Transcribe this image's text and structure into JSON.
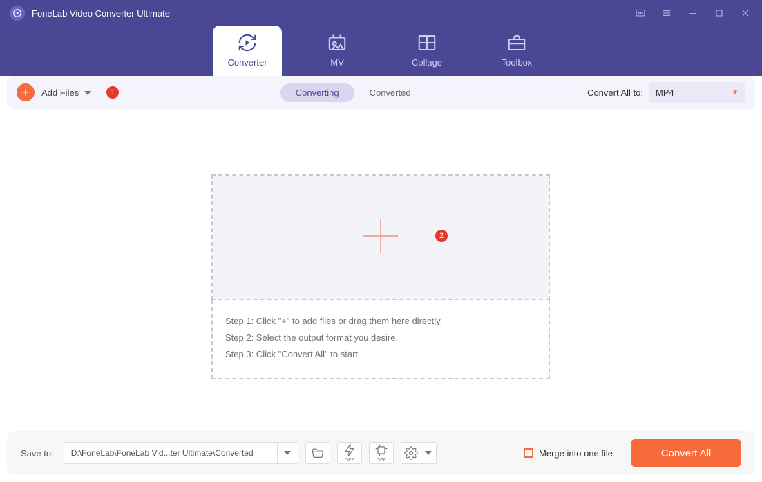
{
  "app": {
    "title": "FoneLab Video Converter Ultimate"
  },
  "nav": {
    "converter": "Converter",
    "mv": "MV",
    "collage": "Collage",
    "toolbox": "Toolbox"
  },
  "toolbar": {
    "add_files": "Add Files",
    "badge1": "1",
    "seg_converting": "Converting",
    "seg_converted": "Converted",
    "convert_all_to_label": "Convert All to:",
    "format_selected": "MP4"
  },
  "dropzone": {
    "badge2": "2",
    "step1": "Step 1: Click \"+\" to add files or drag them here directly.",
    "step2": "Step 2: Select the output format you desire.",
    "step3": "Step 3: Click \"Convert All\" to start."
  },
  "footer": {
    "save_to_label": "Save to:",
    "save_path": "D:\\FoneLab\\FoneLab Vid...ter Ultimate\\Converted",
    "merge_label": "Merge into one file",
    "convert_all_btn": "Convert All",
    "off": "OFF"
  }
}
